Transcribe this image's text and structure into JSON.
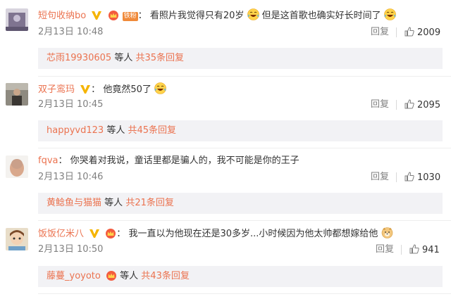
{
  "reply_label": "回复",
  "sub_mid_text": "等人",
  "colors": {
    "accent": "#eb7350",
    "meta": "#808080",
    "reply_box": "#f2f2f5"
  },
  "comments": [
    {
      "user": "短句收纳bo",
      "badges": [
        "vip-v-icon",
        "crown-icon",
        "fan-badge"
      ],
      "fan_badge_text": "铁粉",
      "text_a": "看照片我觉得只有20岁",
      "text_b": "但是这首歌也确实好长时间了",
      "emojis": [
        "laugh-cry-emoji",
        "laugh-cry-emoji"
      ],
      "time": "2月13日 10:48",
      "likes": "2009",
      "sub_user": "芯雨19930605",
      "sub_more": "共35条回复"
    },
    {
      "user": "双子鸾玛",
      "badges": [
        "vip-v-icon"
      ],
      "text_a": "他竟然50了",
      "emojis": [
        "laugh-cry-emoji"
      ],
      "time": "2月13日 10:45",
      "likes": "2095",
      "sub_user": "happyvd123",
      "sub_more": "共45条回复"
    },
    {
      "user": "fqva",
      "text_a": "你哭着对我说，童话里都是骗人的，我不可能是你的王子",
      "time": "2月13日 10:46",
      "likes": "1030",
      "sub_user": "黄鲶鱼与猫猫",
      "sub_more": "共21条回复"
    },
    {
      "user": "饭饭亿米八",
      "badges": [
        "vip-v-icon",
        "crown-icon"
      ],
      "text_a": "我一直以为他现在还是30多岁...小时候因为他太帅都想嫁给他",
      "emojis": [
        "dog-emoji"
      ],
      "time": "2月13日 10:50",
      "likes": "941",
      "sub_user": "藤蔓_yoyoto",
      "sub_badges": [
        "crown-icon"
      ],
      "sub_more": "共43条回复"
    }
  ]
}
